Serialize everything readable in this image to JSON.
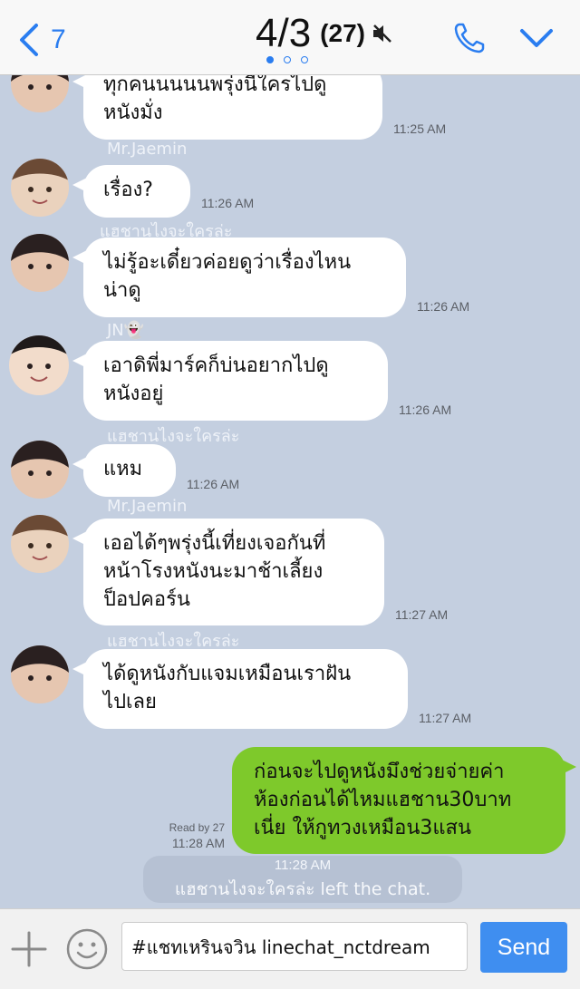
{
  "header": {
    "back_count": "7",
    "title": "4/3",
    "member_count": "(27)",
    "page_dots": 3,
    "active_dot": 0
  },
  "messages": [
    {
      "sender": "",
      "text_lines": [
        "ทุกคนนนนนพรุ่งนี้ใครไปดู",
        "หนังมั่ง"
      ],
      "time": "11:25 AM"
    },
    {
      "sender": "Mr.Jaemin",
      "text_lines": [
        "เรื่อง?"
      ],
      "time": "11:26 AM"
    },
    {
      "sender": "แฮชานไงจะใครล่ะ",
      "text_lines": [
        "ไม่รู้อะเดี๋ยวค่อยดูว่าเรื่องไหน",
        "น่าดู"
      ],
      "time": "11:26 AM"
    },
    {
      "sender": "JN👻",
      "text_lines": [
        "เอาดิพี่มาร์คก็บ่นอยากไปดู",
        "หนังอยู่"
      ],
      "time": "11:26 AM"
    },
    {
      "sender": "แฮชานไงจะใครล่ะ",
      "text_lines": [
        "แหม"
      ],
      "time": "11:26 AM"
    },
    {
      "sender": "Mr.Jaemin",
      "text_lines": [
        "เออได้ๆพรุ่งนี้เที่ยงเจอกันที่",
        "หน้าโรงหนังนะมาช้าเลี้ยง",
        "ป็อปคอร์น"
      ],
      "time": "11:27 AM"
    },
    {
      "sender": "แฮชานไงจะใครล่ะ",
      "text_lines": [
        "ได้ดูหนังกับแจมเหมือนเราฝัน",
        "ไปเลย"
      ],
      "time": "11:27 AM"
    }
  ],
  "outgoing": {
    "text_lines": [
      "ก่อนจะไปดูหนังมึงช่วยจ่ายค่า",
      "ห้องก่อนได้ไหมแฮชาน30บาท",
      "เนี่ย ให้กูทวงเหมือน3แสน"
    ],
    "read_label": "Read by 27",
    "time": "11:28 AM"
  },
  "system_notice": {
    "time": "11:28 AM",
    "text": "แฮชานไงจะใครล่ะ left the chat."
  },
  "input_bar": {
    "value": "#แชทเหรินจวิน linechat_nctdream",
    "send_label": "Send"
  },
  "colors": {
    "accent": "#2a7df0",
    "background": "#c4cfe0",
    "outgoing_bubble": "#7ec92b",
    "send_button": "#3f8ef0"
  }
}
